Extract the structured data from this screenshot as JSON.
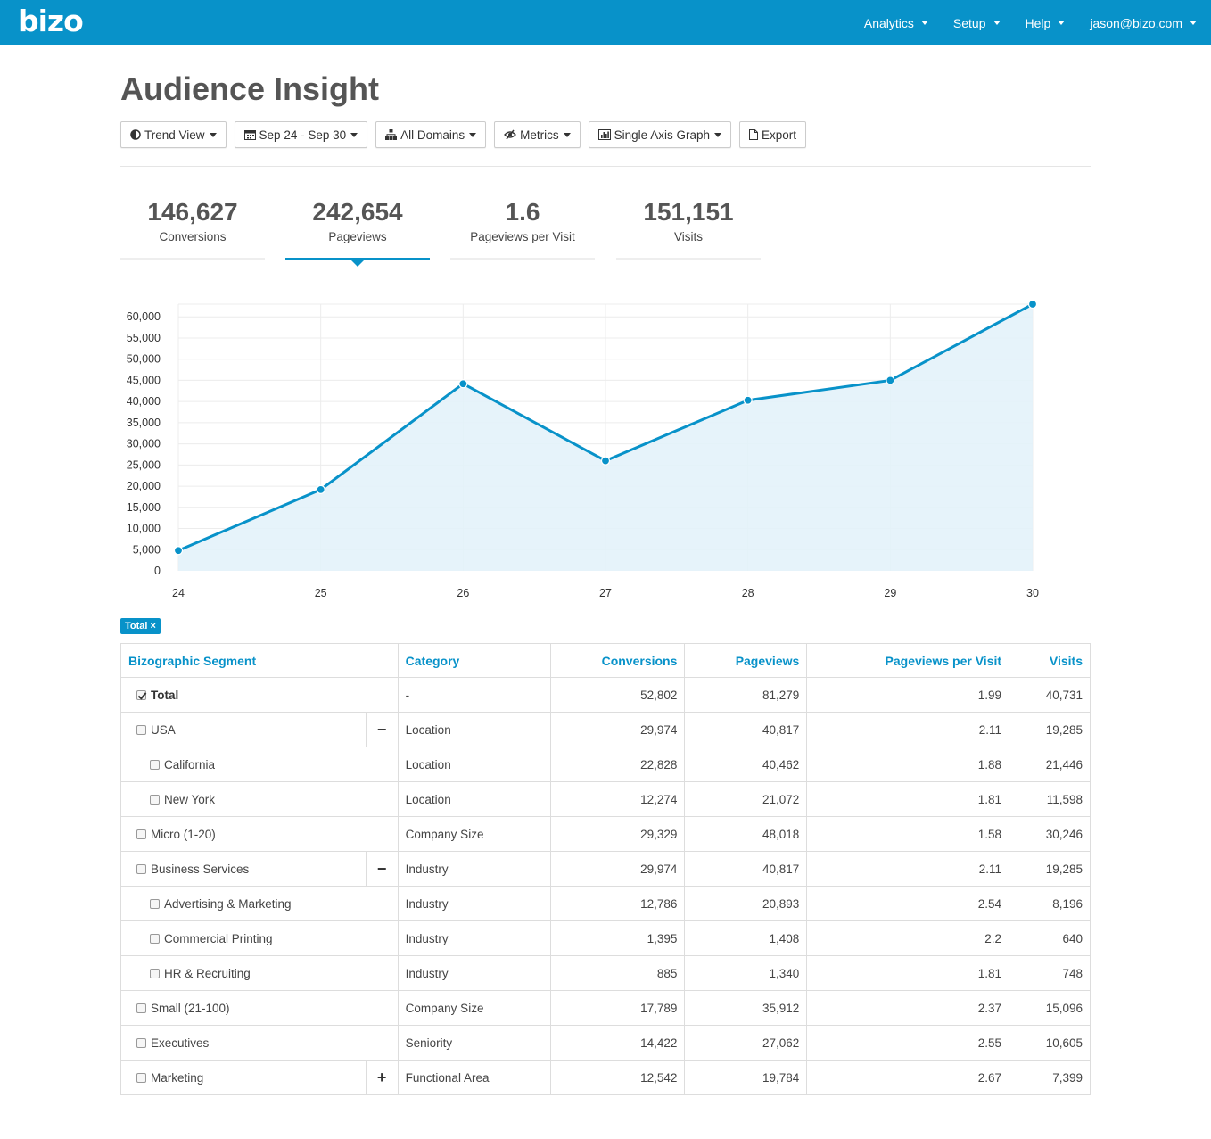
{
  "brand": "bizo",
  "nav": {
    "analytics": "Analytics",
    "setup": "Setup",
    "help": "Help",
    "user": "jason@bizo.com"
  },
  "page_title": "Audience Insight",
  "toolbar": {
    "trend_view": "Trend View",
    "date_range": "Sep 24 - Sep 30",
    "domains": "All Domains",
    "metrics": "Metrics",
    "graph_type": "Single Axis Graph",
    "export": "Export"
  },
  "metrics": [
    {
      "value": "146,627",
      "label": "Conversions"
    },
    {
      "value": "242,654",
      "label": "Pageviews",
      "active": true
    },
    {
      "value": "1.6",
      "label": "Pageviews per Visit"
    },
    {
      "value": "151,151",
      "label": "Visits"
    }
  ],
  "chart_data": {
    "type": "area",
    "x": [
      "24",
      "25",
      "26",
      "27",
      "28",
      "29",
      "30"
    ],
    "series": [
      {
        "values": [
          4800,
          19200,
          44200,
          26000,
          40300,
          45000,
          63000
        ]
      }
    ],
    "yticks": [
      "0",
      "5,000",
      "10,000",
      "15,000",
      "20,000",
      "25,000",
      "30,000",
      "35,000",
      "40,000",
      "45,000",
      "50,000",
      "55,000",
      "60,000"
    ],
    "ylim": [
      0,
      63000
    ],
    "grid": true,
    "color": "#0892c9",
    "fill_color": "#e3f2f9"
  },
  "filter_tag": "Total ×",
  "table": {
    "headers": [
      "Bizographic Segment",
      "Category",
      "Conversions",
      "Pageviews",
      "Pageviews per Visit",
      "Visits"
    ],
    "rows": [
      {
        "segment": "Total",
        "category": "-",
        "conversions": "52,802",
        "pageviews": "81,279",
        "ppv": "1.99",
        "visits": "40,731",
        "checked": true,
        "bold": true
      },
      {
        "segment": "USA",
        "category": "Location",
        "conversions": "29,974",
        "pageviews": "40,817",
        "ppv": "2.11",
        "visits": "19,285",
        "toggle": "−"
      },
      {
        "segment": "California",
        "category": "Location",
        "conversions": "22,828",
        "pageviews": "40,462",
        "ppv": "1.88",
        "visits": "21,446",
        "child": true
      },
      {
        "segment": "New York",
        "category": "Location",
        "conversions": "12,274",
        "pageviews": "21,072",
        "ppv": "1.81",
        "visits": "11,598",
        "child": true
      },
      {
        "segment": "Micro (1-20)",
        "category": "Company Size",
        "conversions": "29,329",
        "pageviews": "48,018",
        "ppv": "1.58",
        "visits": "30,246"
      },
      {
        "segment": "Business Services",
        "category": "Industry",
        "conversions": "29,974",
        "pageviews": "40,817",
        "ppv": "2.11",
        "visits": "19,285",
        "toggle": "−"
      },
      {
        "segment": "Advertising & Marketing",
        "category": "Industry",
        "conversions": "12,786",
        "pageviews": "20,893",
        "ppv": "2.54",
        "visits": "8,196",
        "child": true
      },
      {
        "segment": "Commercial Printing",
        "category": "Industry",
        "conversions": "1,395",
        "pageviews": "1,408",
        "ppv": "2.2",
        "visits": "640",
        "child": true
      },
      {
        "segment": "HR & Recruiting",
        "category": "Industry",
        "conversions": "885",
        "pageviews": "1,340",
        "ppv": "1.81",
        "visits": "748",
        "child": true
      },
      {
        "segment": "Small (21-100)",
        "category": "Company Size",
        "conversions": "17,789",
        "pageviews": "35,912",
        "ppv": "2.37",
        "visits": "15,096"
      },
      {
        "segment": "Executives",
        "category": "Seniority",
        "conversions": "14,422",
        "pageviews": "27,062",
        "ppv": "2.55",
        "visits": "10,605"
      },
      {
        "segment": "Marketing",
        "category": "Functional Area",
        "conversions": "12,542",
        "pageviews": "19,784",
        "ppv": "2.67",
        "visits": "7,399",
        "toggle": "+"
      }
    ]
  }
}
